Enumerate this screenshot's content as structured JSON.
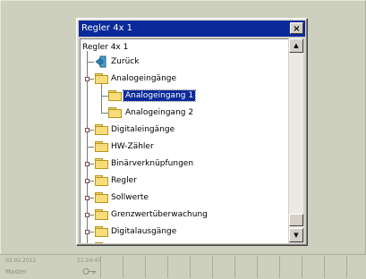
{
  "dialog": {
    "title": "Regler 4x 1",
    "close_label": "×",
    "tree": {
      "root_label": "Regler 4x 1",
      "back_label": "Zurück",
      "items": [
        {
          "label": "Analogeingänge",
          "level": 1,
          "expanded": true
        },
        {
          "label": "Analogeingang 1",
          "level": 2,
          "selected": true
        },
        {
          "label": "Analogeingang 2",
          "level": 2
        },
        {
          "label": "Digitaleingänge",
          "level": 1
        },
        {
          "label": "HW-Zähler",
          "level": 1
        },
        {
          "label": "Binärverknüpfungen",
          "level": 1
        },
        {
          "label": "Regler",
          "level": 1
        },
        {
          "label": "Sollwerte",
          "level": 1
        },
        {
          "label": "Grenzwertüberwachung",
          "level": 1
        },
        {
          "label": "Digitalausgänge",
          "level": 1
        }
      ]
    },
    "scrollbar": {
      "up_label": "▲",
      "down_label": "▼"
    }
  },
  "taskbar": {
    "date": "02.02.2012",
    "time": "11:24:47",
    "user": "Master",
    "key_icon": "key-icon"
  },
  "colors": {
    "background": "#cdd0be",
    "titlebar": "#0a2a9a",
    "selection": "#0a2a9a",
    "folder": "#f7dd7a"
  }
}
